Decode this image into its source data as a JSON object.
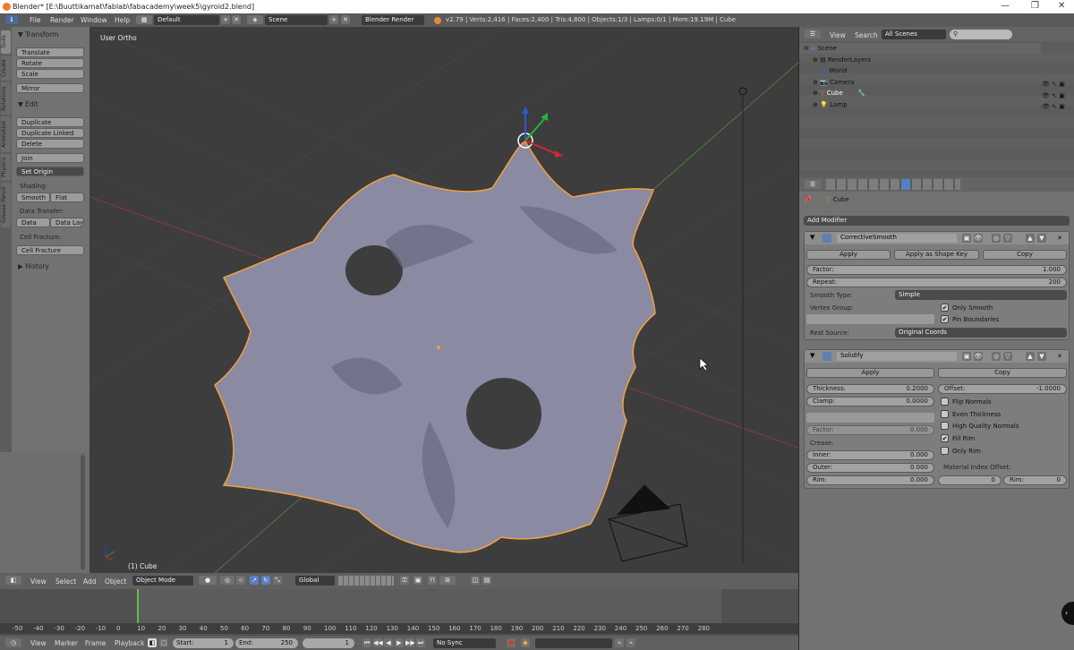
{
  "window": {
    "title": "Blender* [E:\\Buuttikamat\\fablab\\fabacademy\\week5\\gyroid2.blend]",
    "minimize": "—",
    "maximize": "❐",
    "close": "✕"
  },
  "infobar": {
    "menus": [
      "File",
      "Render",
      "Window",
      "Help"
    ],
    "layout": "Default",
    "scene": "Scene",
    "engine": "Blender Render",
    "stats": "v2.79 | Verts:2,416 | Faces:2,400 | Tris:4,800 | Objects:1/3 | Lamps:0/1 | Mem:19.19M | Cube"
  },
  "toolshelf": {
    "tabs": [
      "Tools",
      "Create",
      "Relations",
      "Animation",
      "Physics",
      "Grease Pencil"
    ],
    "transform_header": "Transform",
    "translate": "Translate",
    "rotate": "Rotate",
    "scale": "Scale",
    "mirror": "Mirror",
    "edit_header": "Edit",
    "duplicate": "Duplicate",
    "duplicate_linked": "Duplicate Linked",
    "delete": "Delete",
    "join": "Join",
    "set_origin": "Set Origin",
    "shading_label": "Shading:",
    "smooth": "Smooth",
    "flat": "Flat",
    "data_transfer_label": "Data Transfer:",
    "data": "Data",
    "data_layo": "Data Layo",
    "cell_fracture_label": "Cell Fracture:",
    "cell_fracture": "Cell Fracture",
    "history_header": "History"
  },
  "viewport": {
    "view_name": "User Ortho",
    "object_label": "(1) Cube"
  },
  "viewport_header": {
    "menus": [
      "View",
      "Select",
      "Add",
      "Object"
    ],
    "mode": "Object Mode",
    "orientation": "Global"
  },
  "timeline": {
    "ticks": [
      "-50",
      "-40",
      "-30",
      "-20",
      "-10",
      "0",
      "10",
      "20",
      "30",
      "40",
      "50",
      "60",
      "70",
      "80",
      "90",
      "100",
      "110",
      "120",
      "130",
      "140",
      "150",
      "160",
      "170",
      "180",
      "190",
      "200",
      "210",
      "220",
      "230",
      "240",
      "250",
      "260",
      "270",
      "280"
    ],
    "current_frame": 1,
    "menus": [
      "View",
      "Marker",
      "Frame",
      "Playback"
    ],
    "start_label": "Start:",
    "start": "1",
    "end_label": "End:",
    "end": "250",
    "frame": "1",
    "sync": "No Sync"
  },
  "outliner": {
    "menus": [
      "View",
      "Search"
    ],
    "filter": "All Scenes",
    "items": [
      "Scene",
      "RenderLayers",
      "World",
      "Camera",
      "Cube",
      "Lamp"
    ]
  },
  "properties": {
    "breadcrumb_object": "Cube",
    "add_modifier": "Add Modifier",
    "mod1": {
      "name": "CorrectiveSmooth",
      "apply": "Apply",
      "apply_shape": "Apply as Shape Key",
      "copy": "Copy",
      "factor_label": "Factor:",
      "factor": "1.000",
      "repeat_label": "Repeat:",
      "repeat": "200",
      "smooth_type_label": "Smooth Type:",
      "smooth_type": "Simple",
      "vertex_group_label": "Vertex Group:",
      "only_smooth": "Only Smooth",
      "pin_boundaries": "Pin Boundaries",
      "rest_source_label": "Rest Source:",
      "rest_source": "Original Coords"
    },
    "mod2": {
      "name": "Solidify",
      "apply": "Apply",
      "copy": "Copy",
      "thickness_label": "Thickness:",
      "thickness": "0.2000",
      "offset_label": "Offset:",
      "offset": "-1.0000",
      "clamp_label": "Clamp:",
      "clamp": "0.0000",
      "flip_normals": "Flip Normals",
      "even_thickness": "Even Thickness",
      "high_quality_normals": "High Quality Normals",
      "fill_rim": "Fill Rim",
      "only_rim": "Only Rim",
      "factor_label": "Factor:",
      "factor": "0.000",
      "crease_label": "Crease:",
      "inner_label": "Inner:",
      "inner": "0.000",
      "outer_label": "Outer:",
      "outer": "0.000",
      "rim_label": "Rim:",
      "rim": "0.000",
      "mat_offset_label": "Material Index Offset:",
      "mat_offset": "0",
      "mat_rim_label": "Rim:",
      "mat_rim": "0"
    }
  },
  "colors": {
    "accent": "#5680c2",
    "selection": "#f2a13c",
    "mesh": "#8a8aa2"
  }
}
